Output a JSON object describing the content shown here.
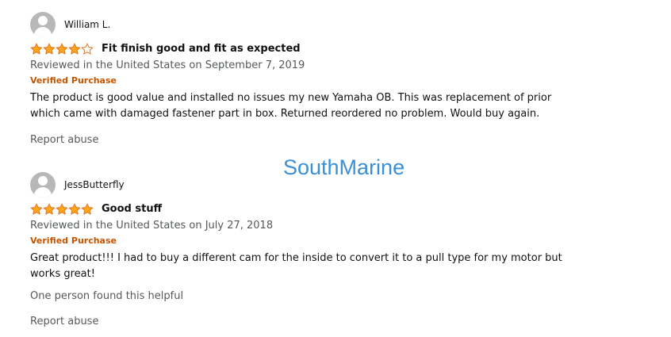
{
  "watermark": "SouthMarine",
  "colors": {
    "star_fill": "#ffa41c",
    "star_stroke": "#de7921",
    "verified": "#c45500",
    "watermark": "#3a8fd6",
    "secondary_text": "#565959"
  },
  "reviews": [
    {
      "username": "William L.",
      "avatar_icon": "user-avatar-icon",
      "rating": 4,
      "rating_max": 5,
      "title": "Fit finish good and fit as expected",
      "date": "Reviewed in the United States on September 7, 2019",
      "verified": "Verified Purchase",
      "body": "The product is good value and installed no issues my new Yamaha OB. This was replacement of prior which came with damaged fastener part in box. Returned reordered no problem. Would buy again.",
      "helpful": "",
      "report": "Report abuse"
    },
    {
      "username": "JessButterfly",
      "avatar_icon": "user-avatar-icon",
      "rating": 5,
      "rating_max": 5,
      "title": "Good stuff",
      "date": "Reviewed in the United States on July 27, 2018",
      "verified": "Verified Purchase",
      "body": "Great product!!! I had to buy a different cam for the inside to convert it to a pull type for my motor but works great!",
      "helpful": "One person found this helpful",
      "report": "Report abuse"
    }
  ]
}
